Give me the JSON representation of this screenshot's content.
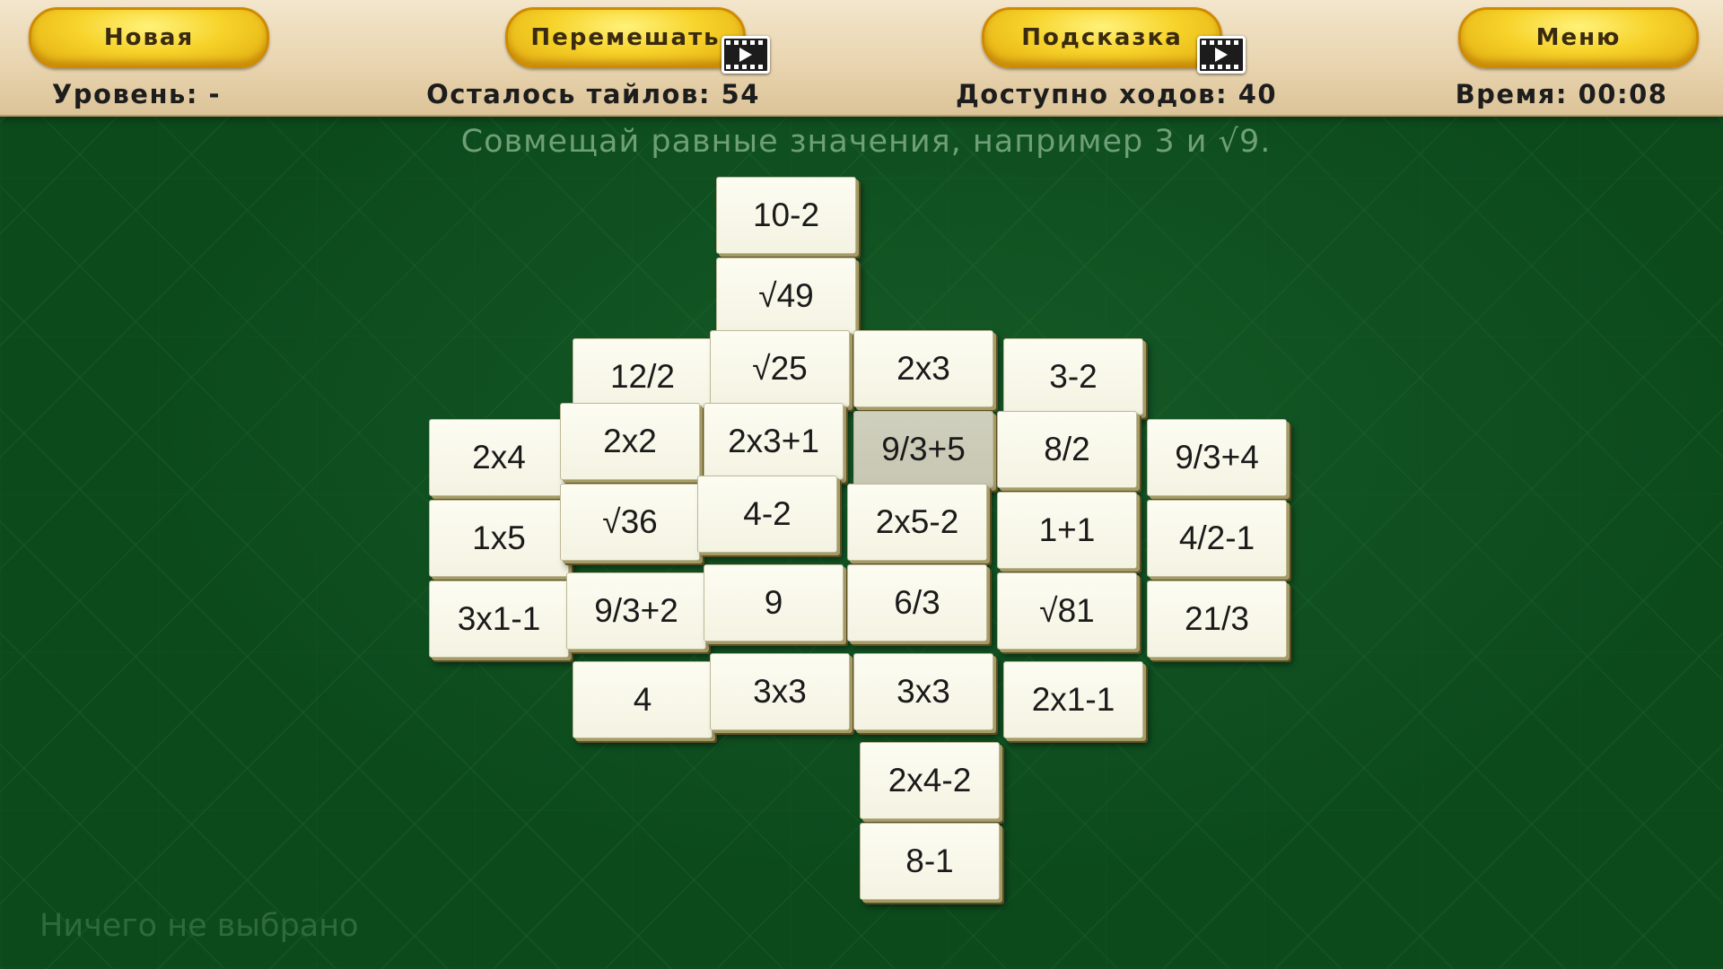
{
  "toolbar": {
    "new_label": "Новая",
    "shuffle_label": "Перемешать",
    "hint_label": "Подсказка",
    "menu_label": "Меню",
    "video_icon": "video-play-icon"
  },
  "stats": {
    "level": "Уровень: -",
    "tiles_left": "Осталось тайлов: 54",
    "moves_available": "Доступно ходов: 40",
    "time": "Время:  00:08"
  },
  "hint_text": "Совмещай равные значения, например 3 и √9.",
  "status_text": "Ничего не выбрано",
  "colors": {
    "button_gold": "#f7d32a",
    "topbar": "#e9d5b0",
    "background_green": "#0c4a1c",
    "tile_face": "#f4f3e2",
    "tile_dim": "#c6c6b2"
  },
  "tiles": [
    {
      "label": "10-2"
    },
    {
      "label": "√49"
    },
    {
      "label": "12/2"
    },
    {
      "label": "√25"
    },
    {
      "label": "2x3"
    },
    {
      "label": "3-2"
    },
    {
      "label": "2x4"
    },
    {
      "label": "2x2"
    },
    {
      "label": "2x3+1"
    },
    {
      "label": "9/3+5",
      "dim": true
    },
    {
      "label": "8/2"
    },
    {
      "label": "9/3+4"
    },
    {
      "label": "1x5"
    },
    {
      "label": "√36"
    },
    {
      "label": "4-2"
    },
    {
      "label": "2x5-2"
    },
    {
      "label": "1+1"
    },
    {
      "label": "4/2-1"
    },
    {
      "label": "3x1-1"
    },
    {
      "label": "9/3+2"
    },
    {
      "label": "9"
    },
    {
      "label": "6/3"
    },
    {
      "label": "√81"
    },
    {
      "label": "21/3"
    },
    {
      "label": "4"
    },
    {
      "label": "3x3"
    },
    {
      "label": "3x3"
    },
    {
      "label": "2x1-1"
    },
    {
      "label": "2x4-2"
    },
    {
      "label": "8-1"
    }
  ]
}
